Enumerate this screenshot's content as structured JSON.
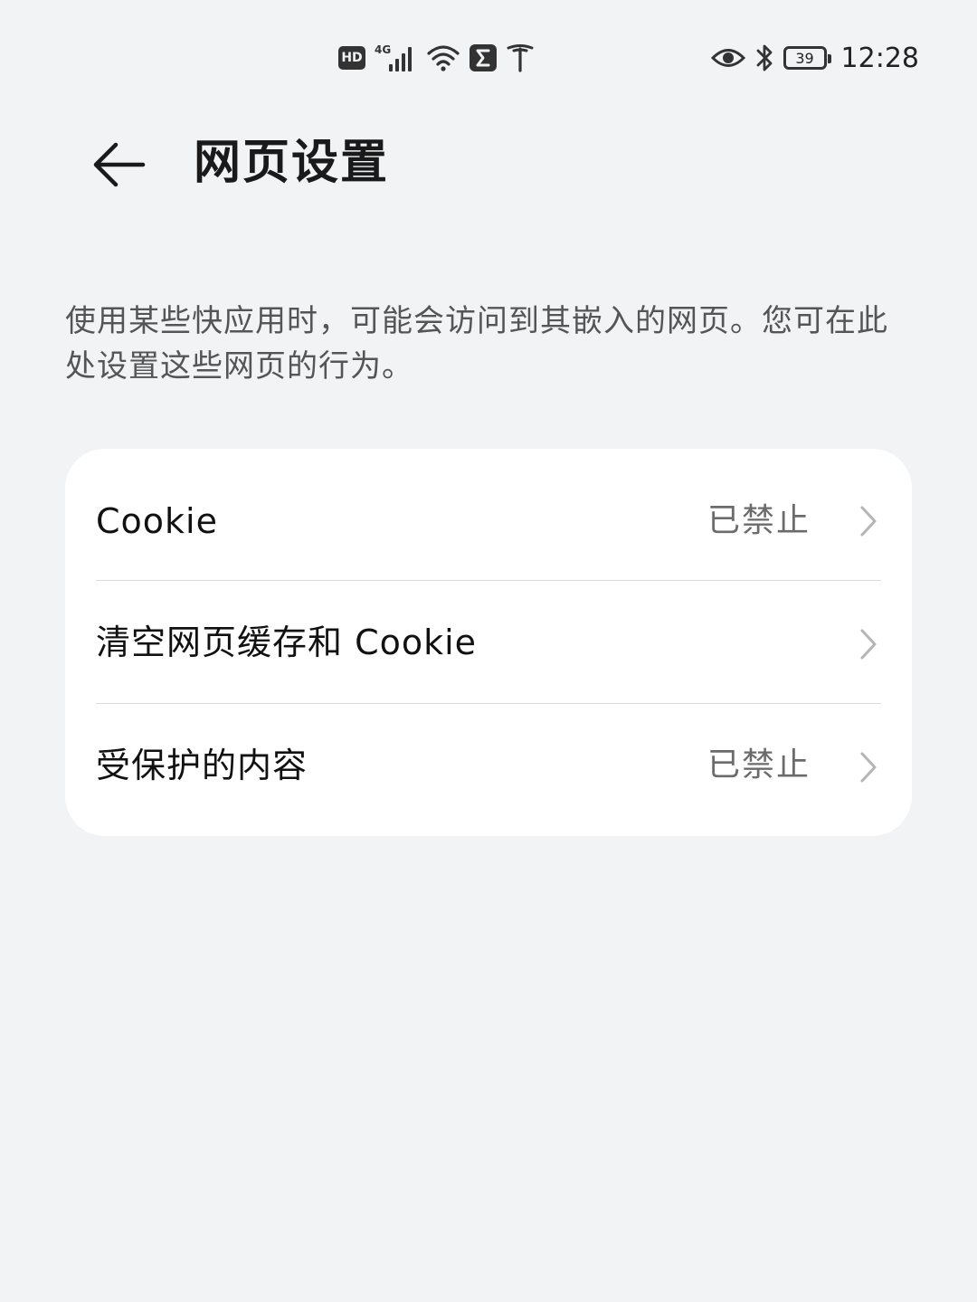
{
  "status_bar": {
    "hd_label": "HD",
    "network_label": "4G",
    "battery_level": "39",
    "time": "12:28",
    "icons": [
      "hd-icon",
      "signal-icon",
      "wifi-icon",
      "sigma-app-icon",
      "tesla-icon",
      "eye-icon",
      "bluetooth-icon",
      "battery-icon"
    ]
  },
  "header": {
    "title": "网页设置",
    "back_icon": "arrow-left-icon"
  },
  "description": "使用某些快应用时，可能会访问到其嵌入的网页。您可在此处设置这些网页的行为。",
  "settings": {
    "items": [
      {
        "label": "Cookie",
        "value": "已禁止",
        "icon": "chevron-right-icon"
      },
      {
        "label": "清空网页缓存和 Cookie",
        "value": "",
        "icon": "chevron-right-icon"
      },
      {
        "label": "受保护的内容",
        "value": "已禁止",
        "icon": "chevron-right-icon"
      }
    ]
  },
  "colors": {
    "background": "#f1f3f5",
    "card": "#ffffff",
    "secondary_text": "#6b6b6b"
  }
}
